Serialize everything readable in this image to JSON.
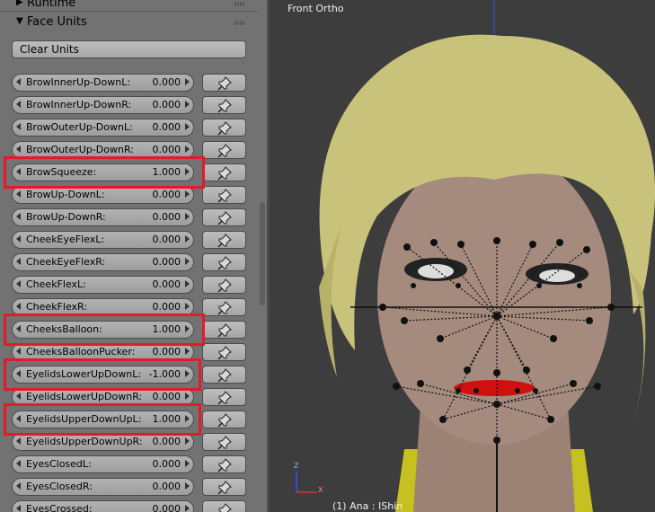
{
  "panel": {
    "runtime_header": "Runtime",
    "face_units_header": "Face Units",
    "clear_button": "Clear Units",
    "units": [
      {
        "label": "BrowInnerUp-DownL:",
        "value": "0.000",
        "highlighted": false
      },
      {
        "label": "BrowInnerUp-DownR:",
        "value": "0.000",
        "highlighted": false
      },
      {
        "label": "BrowOuterUp-DownL:",
        "value": "0.000",
        "highlighted": false
      },
      {
        "label": "BrowOuterUp-DownR:",
        "value": "0.000",
        "highlighted": false
      },
      {
        "label": "BrowSqueeze:",
        "value": "1.000",
        "highlighted": true
      },
      {
        "label": "BrowUp-DownL:",
        "value": "0.000",
        "highlighted": false
      },
      {
        "label": "BrowUp-DownR:",
        "value": "0.000",
        "highlighted": false
      },
      {
        "label": "CheekEyeFlexL:",
        "value": "0.000",
        "highlighted": false
      },
      {
        "label": "CheekEyeFlexR:",
        "value": "0.000",
        "highlighted": false
      },
      {
        "label": "CheekFlexL:",
        "value": "0.000",
        "highlighted": false
      },
      {
        "label": "CheekFlexR:",
        "value": "0.000",
        "highlighted": false
      },
      {
        "label": "CheeksBalloon:",
        "value": "1.000",
        "highlighted": true
      },
      {
        "label": "CheeksBalloonPucker:",
        "value": "0.000",
        "highlighted": false
      },
      {
        "label": "EyelidsLowerUpDownL:",
        "value": "-1.000",
        "highlighted": true
      },
      {
        "label": "EyelidsLowerUpDownR:",
        "value": "0.000",
        "highlighted": false
      },
      {
        "label": "EyelidsUpperDownUpL:",
        "value": "1.000",
        "highlighted": true
      },
      {
        "label": "EyelidsUpperDownUpR:",
        "value": "0.000",
        "highlighted": false
      },
      {
        "label": "EyesClosedL:",
        "value": "0.000",
        "highlighted": false
      },
      {
        "label": "EyesClosedR:",
        "value": "0.000",
        "highlighted": false
      },
      {
        "label": "EyesCrossed:",
        "value": "0.000",
        "highlighted": false
      }
    ]
  },
  "viewport": {
    "view_name": "Front Ortho",
    "status": "(1) Ana : IShin",
    "axis_labels": {
      "z": "Z",
      "x": "X"
    }
  },
  "colors": {
    "panel_bg": "#727272",
    "highlight": "#e41a2a",
    "hair": "#c8c27a",
    "skin": "#a58a7e",
    "shirt": "#c6c020",
    "lips": "#d01010"
  },
  "icons": {
    "pin": "pin-icon",
    "left_arrow": "decrement-arrow-icon",
    "right_arrow": "increment-arrow-icon"
  }
}
